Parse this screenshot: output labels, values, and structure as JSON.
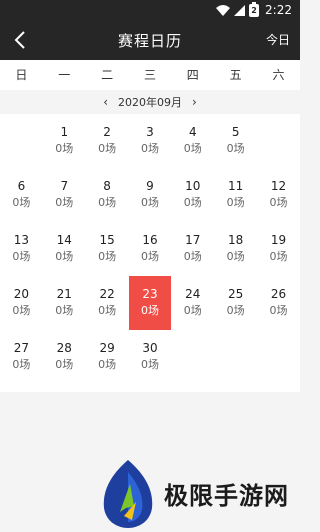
{
  "status_bar": {
    "time": "2:22",
    "battery_label": "2"
  },
  "header": {
    "title": "赛程日历",
    "today_label": "今日"
  },
  "weekdays": [
    "日",
    "一",
    "二",
    "三",
    "四",
    "五",
    "六"
  ],
  "month_nav": {
    "prev": "‹",
    "label": "2020年09月",
    "next": "›"
  },
  "calendar": {
    "selected_day": "23",
    "weeks": [
      [
        null,
        {
          "day": "1",
          "count": "0场"
        },
        {
          "day": "2",
          "count": "0场"
        },
        {
          "day": "3",
          "count": "0场"
        },
        {
          "day": "4",
          "count": "0场"
        },
        {
          "day": "5",
          "count": "0场"
        },
        null
      ],
      [
        {
          "day": "6",
          "count": "0场"
        },
        {
          "day": "7",
          "count": "0场"
        },
        {
          "day": "8",
          "count": "0场"
        },
        {
          "day": "9",
          "count": "0场"
        },
        {
          "day": "10",
          "count": "0场"
        },
        {
          "day": "11",
          "count": "0场"
        },
        {
          "day": "12",
          "count": "0场"
        }
      ],
      [
        {
          "day": "13",
          "count": "0场"
        },
        {
          "day": "14",
          "count": "0场"
        },
        {
          "day": "15",
          "count": "0场"
        },
        {
          "day": "16",
          "count": "0场"
        },
        {
          "day": "17",
          "count": "0场"
        },
        {
          "day": "18",
          "count": "0场"
        },
        {
          "day": "19",
          "count": "0场"
        }
      ],
      [
        {
          "day": "20",
          "count": "0场"
        },
        {
          "day": "21",
          "count": "0场"
        },
        {
          "day": "22",
          "count": "0场"
        },
        {
          "day": "23",
          "count": "0场"
        },
        {
          "day": "24",
          "count": "0场"
        },
        {
          "day": "25",
          "count": "0场"
        },
        {
          "day": "26",
          "count": "0场"
        }
      ],
      [
        {
          "day": "27",
          "count": "0场"
        },
        {
          "day": "28",
          "count": "0场"
        },
        {
          "day": "29",
          "count": "0场"
        },
        {
          "day": "30",
          "count": "0场"
        },
        null,
        null,
        null
      ]
    ]
  },
  "watermark": {
    "text": "极限手游网"
  },
  "colors": {
    "header_bg": "#262626",
    "selected_bg": "#ef4d46",
    "page_bg": "#f4f4f4"
  }
}
